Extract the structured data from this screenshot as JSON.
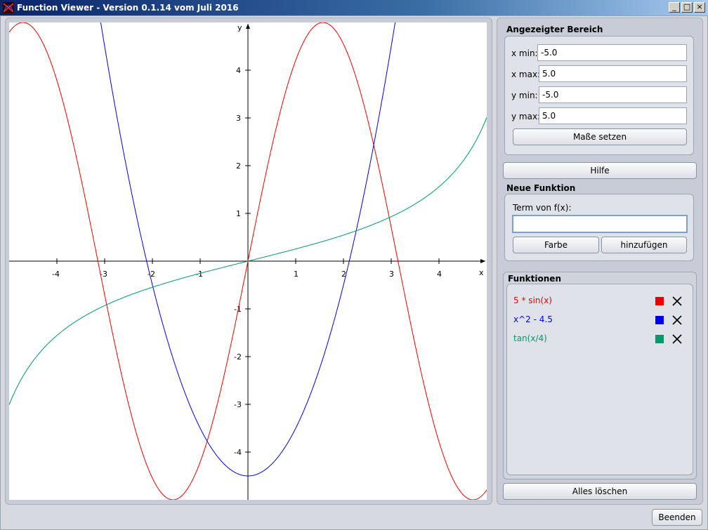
{
  "window": {
    "title": "Function Viewer - Version 0.1.14 vom Juli 2016",
    "minimize": "_",
    "maximize": "□",
    "close": "×"
  },
  "plot": {
    "xmin": -5.0,
    "xmax": 5.0,
    "ymin": -5.0,
    "ymax": 5.0,
    "x_axis_label": "x",
    "y_axis_label": "y",
    "x_ticks": [
      -4,
      -3,
      -2,
      -1,
      1,
      2,
      3,
      4
    ],
    "y_ticks": [
      -4,
      -3,
      -2,
      -1,
      1,
      2,
      3,
      4
    ]
  },
  "range_group": {
    "title": "Angezeigter Bereich",
    "xmin_label": "x min:",
    "xmin_value": "-5.0",
    "xmax_label": "x max:",
    "xmax_value": "5.0",
    "ymin_label": "y min:",
    "ymin_value": "-5.0",
    "ymax_label": "y max:",
    "ymax_value": "5.0",
    "set_button": "Maße setzen"
  },
  "help_button": "Hilfe",
  "new_function": {
    "title": "Neue Funktion",
    "term_label": "Term von f(x):",
    "term_value": "",
    "color_button": "Farbe",
    "add_button": "hinzufügen"
  },
  "functions": {
    "title": "Funktionen",
    "items": [
      {
        "term": "5 * sin(x)",
        "color": "#ee0000"
      },
      {
        "term": "x^2 - 4.5",
        "color": "#0000ee"
      },
      {
        "term": "tan(x/4)",
        "color": "#00996b"
      }
    ],
    "clear_button": "Alles löschen"
  },
  "exit_button": "Beenden"
}
